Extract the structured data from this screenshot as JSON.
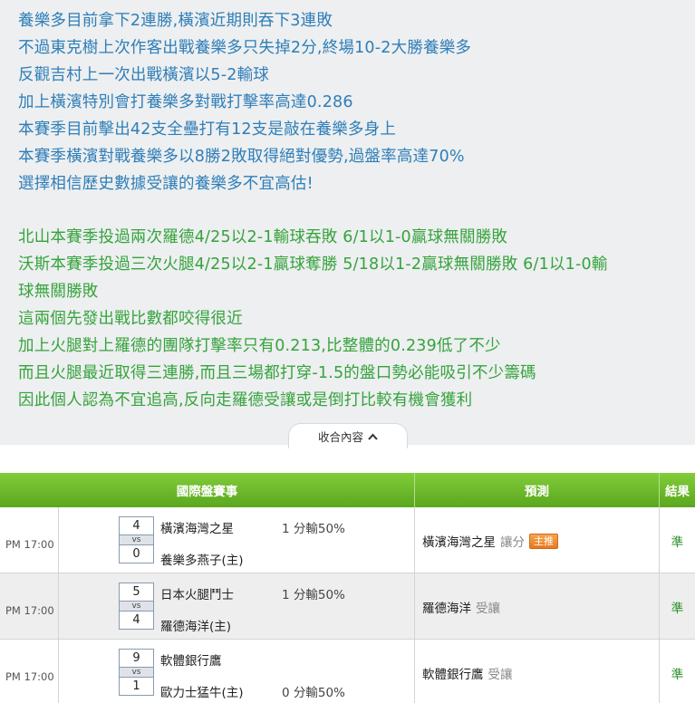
{
  "article": {
    "blue_lines": [
      "養樂多目前拿下2連勝,橫濱近期則吞下3連敗",
      "不過東克樹上次作客出戰養樂多只失掉2分,終場10-2大勝養樂多",
      "反觀吉村上一次出戰橫濱以5-2輸球",
      "加上橫濱特別會打養樂多對戰打擊率高達0.286",
      "本賽季目前擊出42支全壘打有12支是敲在養樂多身上",
      "本賽季橫濱對戰養樂多以8勝2敗取得絕對優勢,過盤率高達70%",
      "選擇相信歷史數據受讓的養樂多不宜高估!"
    ],
    "green_lines": [
      "北山本賽季投過兩次羅德4/25以2-1輸球吞敗 6/1以1-0贏球無關勝敗",
      "沃斯本賽季投過三次火腿4/25以2-1贏球奪勝 5/18以1-2贏球無關勝敗 6/1以1-0輸",
      "球無關勝敗",
      "這兩個先發出戰比數都咬得很近",
      "加上火腿對上羅德的團隊打擊率只有0.213,比整體的0.239低了不少",
      "而且火腿最近取得三連勝,而且三場都打穿-1.5的盤口勢必能吸引不少籌碼",
      "因此個人認為不宜追高,反向走羅德受讓或是倒打比較有機會獲利"
    ]
  },
  "collapse": {
    "label": "收合內容",
    "icon": "chevron-up-icon"
  },
  "table": {
    "headers": {
      "match": "國際盤賽事",
      "prediction": "預測",
      "result": "結果"
    },
    "header_color": "#6ab82a",
    "rows": [
      {
        "time": "PM 17:00",
        "score_top": "4",
        "vs": "vs",
        "score_bottom": "0",
        "team_top": "橫濱海灣之星",
        "team_bottom": "養樂多燕子(主)",
        "handicap_top": "1 分輸50%",
        "handicap_bottom": "",
        "pick_team": "橫濱海灣之星",
        "pick_type": "讓分",
        "badge": "主推",
        "result": "準"
      },
      {
        "time": "PM 17:00",
        "score_top": "5",
        "vs": "vs",
        "score_bottom": "4",
        "team_top": "日本火腿鬥士",
        "team_bottom": "羅德海洋(主)",
        "handicap_top": "1 分輸50%",
        "handicap_bottom": "",
        "pick_team": "羅德海洋",
        "pick_type": "受讓",
        "badge": "",
        "result": "準"
      },
      {
        "time": "PM 17:00",
        "score_top": "9",
        "vs": "vs",
        "score_bottom": "1",
        "team_top": "軟體銀行鷹",
        "team_bottom": "歐力士猛牛(主)",
        "handicap_top": "",
        "handicap_bottom": "0 分輸50%",
        "pick_team": "軟體銀行鷹",
        "pick_type": "受讓",
        "badge": "",
        "result": "準"
      }
    ]
  }
}
